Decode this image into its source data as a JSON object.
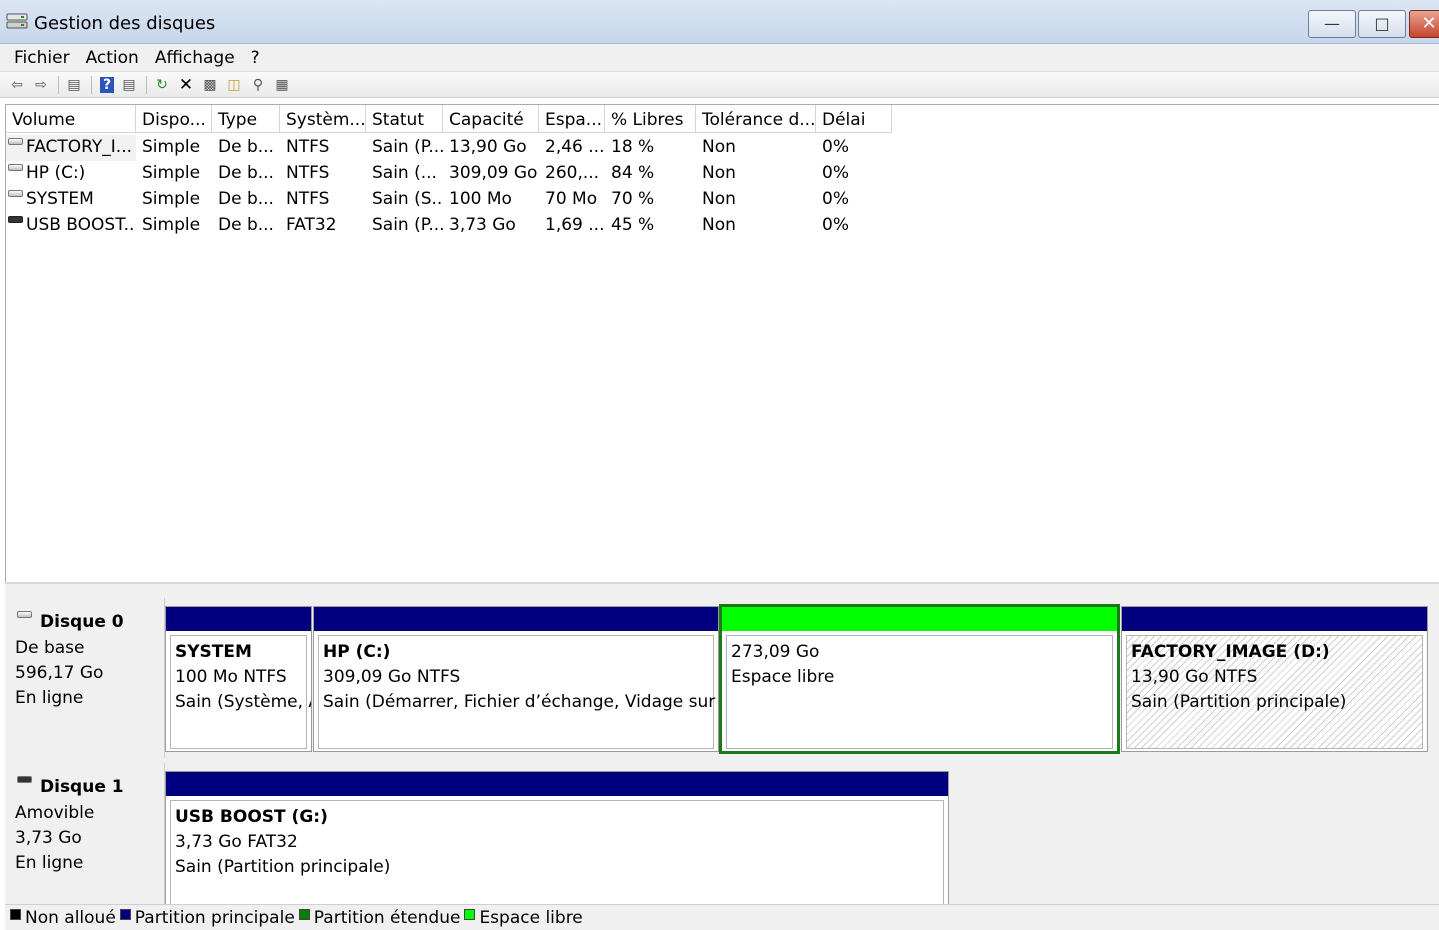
{
  "window": {
    "title": "Gestion des disques"
  },
  "menu": [
    "Fichier",
    "Action",
    "Affichage",
    "?"
  ],
  "toolbar": {
    "icons": [
      "back-icon",
      "forward-icon",
      "view-icon",
      "help-icon",
      "list-icon",
      "refresh-icon",
      "delete-icon",
      "properties-icon",
      "open-icon",
      "explore-icon",
      "settings-icon"
    ]
  },
  "columns": [
    "Volume",
    "Dispo...",
    "Type",
    "Systèm...",
    "Statut",
    "Capacité",
    "Espa...",
    "% Libres",
    "Tolérance d...",
    "Délai"
  ],
  "volumes": [
    {
      "volume": "FACTORY_I...",
      "dispo": "Simple",
      "type": "De b...",
      "fs": "NTFS",
      "statut": "Sain (P...",
      "capacite": "13,90 Go",
      "espace": "2,46 ...",
      "libres": "18 %",
      "tolerance": "Non",
      "delai": "0%"
    },
    {
      "volume": "HP (C:)",
      "dispo": "Simple",
      "type": "De b...",
      "fs": "NTFS",
      "statut": "Sain (...",
      "capacite": "309,09 Go",
      "espace": "260,...",
      "libres": "84 %",
      "tolerance": "Non",
      "delai": "0%"
    },
    {
      "volume": "SYSTEM",
      "dispo": "Simple",
      "type": "De b...",
      "fs": "NTFS",
      "statut": "Sain (S...",
      "capacite": "100 Mo",
      "espace": "70 Mo",
      "libres": "70 %",
      "tolerance": "Non",
      "delai": "0%"
    },
    {
      "volume": "USB BOOST...",
      "dispo": "Simple",
      "type": "De b...",
      "fs": "FAT32",
      "statut": "Sain (P...",
      "capacite": "3,73 Go",
      "espace": "1,69 ...",
      "libres": "45 %",
      "tolerance": "Non",
      "delai": "0%"
    }
  ],
  "disks": [
    {
      "name": "Disque 0",
      "type": "De base",
      "size": "596,17 Go",
      "state": "En ligne",
      "partitions": [
        {
          "title": "SYSTEM",
          "line1": "100 Mo NTFS",
          "line2": "Sain (Système, A"
        },
        {
          "title": "HP  (C:)",
          "line1": "309,09 Go NTFS",
          "line2": "Sain (Démarrer, Fichier d’échange, Vidage sur incid"
        },
        {
          "title": "",
          "line1": "273,09 Go",
          "line2": "Espace libre"
        },
        {
          "title": "FACTORY_IMAGE  (D:)",
          "line1": "13,90 Go NTFS",
          "line2": "Sain (Partition principale)"
        }
      ]
    },
    {
      "name": "Disque 1",
      "type": "Amovible",
      "size": "3,73 Go",
      "state": "En ligne",
      "partitions": [
        {
          "title": "USB BOOST  (G:)",
          "line1": "3,73 Go FAT32",
          "line2": "Sain (Partition principale)"
        }
      ]
    }
  ],
  "legend": [
    {
      "label": "Non alloué",
      "color": "#000000"
    },
    {
      "label": "Partition principale",
      "color": "#00007f"
    },
    {
      "label": "Partition étendue",
      "color": "#007f00"
    },
    {
      "label": "Espace libre",
      "color": "#00ff00"
    }
  ]
}
